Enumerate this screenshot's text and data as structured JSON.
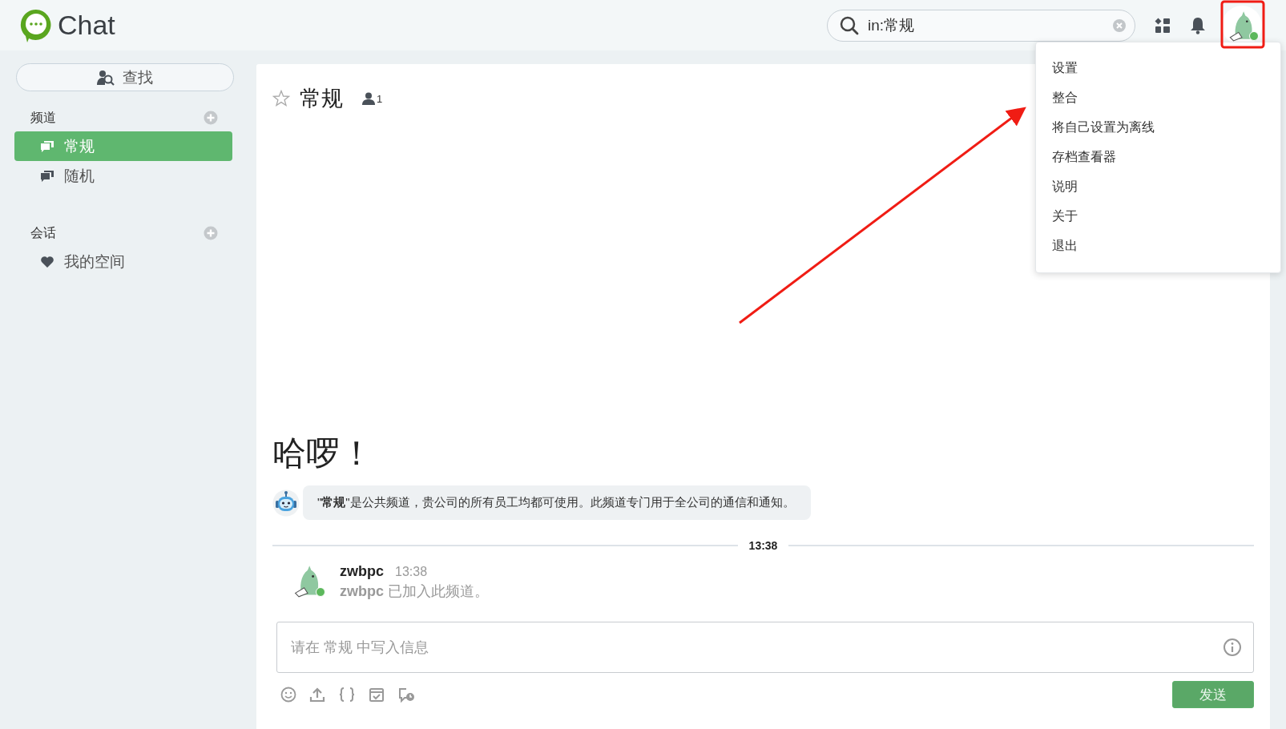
{
  "header": {
    "logo": "Chat",
    "search": {
      "value": "in:常规"
    },
    "user": {
      "online": true
    }
  },
  "sidebar": {
    "find_button": "查找",
    "sections": [
      {
        "title": "频道",
        "items": [
          {
            "label": "常规",
            "kind": "channel",
            "selected": true
          },
          {
            "label": "随机",
            "kind": "channel",
            "selected": false
          }
        ]
      },
      {
        "title": "会话",
        "items": [
          {
            "label": "我的空间",
            "kind": "favorite",
            "selected": false
          }
        ]
      }
    ]
  },
  "channel": {
    "name": "常规",
    "starred": false,
    "member_count": "1",
    "welcome": "哈啰！",
    "intro": "\"**常规**\"是公共频道，贵公司的所有员工均都可使用。此频道专门用于全公司的通信和通知。",
    "divider_time": "13:38",
    "messages": [
      {
        "author": "zwbpc",
        "time": "13:38",
        "online": true,
        "text": "**zwbpc** 已加入此频道。"
      }
    ]
  },
  "composer": {
    "placeholder": "请在 常规 中写入信息",
    "send": {
      "label": "发送",
      "disabled": true
    }
  },
  "user_menu": {
    "items": [
      "设置",
      "整合",
      "将自己设置为离线",
      "存档查看器",
      "说明",
      "关于",
      "退出"
    ]
  }
}
